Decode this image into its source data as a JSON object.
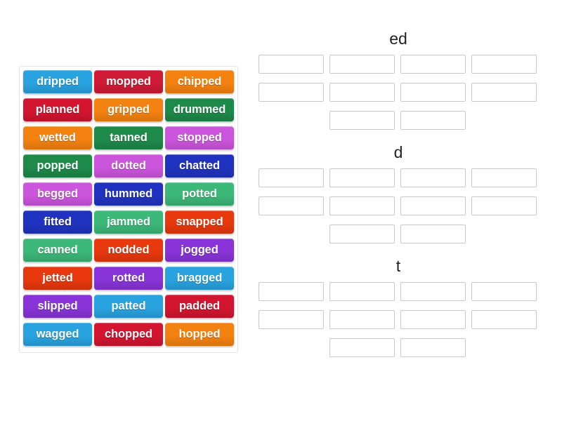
{
  "activity": {
    "type": "group-sort-drag-and-drop",
    "tile_bank": {
      "name": "word-tile-bank",
      "columns": 3,
      "tiles": [
        {
          "label": "dripped",
          "color": "#29a3e0"
        },
        {
          "label": "mopped",
          "color": "#d01b36"
        },
        {
          "label": "chipped",
          "color": "#f48210"
        },
        {
          "label": "planned",
          "color": "#d3152f"
        },
        {
          "label": "gripped",
          "color": "#f48210"
        },
        {
          "label": "drummed",
          "color": "#1d8a4a"
        },
        {
          "label": "wetted",
          "color": "#f48210"
        },
        {
          "label": "tanned",
          "color": "#1d8a4a"
        },
        {
          "label": "stopped",
          "color": "#cc55dd"
        },
        {
          "label": "popped",
          "color": "#1d8a4a"
        },
        {
          "label": "dotted",
          "color": "#cc55dd"
        },
        {
          "label": "chatted",
          "color": "#2033c0"
        },
        {
          "label": "begged",
          "color": "#cc55dd"
        },
        {
          "label": "hummed",
          "color": "#2033c0"
        },
        {
          "label": "potted",
          "color": "#3cb878"
        },
        {
          "label": "fitted",
          "color": "#2033c0"
        },
        {
          "label": "jammed",
          "color": "#3cb878"
        },
        {
          "label": "snapped",
          "color": "#e8380d"
        },
        {
          "label": "canned",
          "color": "#3cb878"
        },
        {
          "label": "nodded",
          "color": "#e8380d"
        },
        {
          "label": "jogged",
          "color": "#8834d8"
        },
        {
          "label": "jetted",
          "color": "#e8380d"
        },
        {
          "label": "rotted",
          "color": "#8834d8"
        },
        {
          "label": "bragged",
          "color": "#29a3e0"
        },
        {
          "label": "slipped",
          "color": "#8834d8"
        },
        {
          "label": "patted",
          "color": "#29a3e0"
        },
        {
          "label": "padded",
          "color": "#d3152f"
        },
        {
          "label": "wagged",
          "color": "#29a3e0"
        },
        {
          "label": "chopped",
          "color": "#d3152f"
        },
        {
          "label": "hopped",
          "color": "#f48210"
        }
      ]
    },
    "groups": [
      {
        "title": "ed",
        "slot_count": 10,
        "slots": [
          "",
          "",
          "",
          "",
          "",
          "",
          "",
          "",
          "",
          ""
        ]
      },
      {
        "title": "d",
        "slot_count": 10,
        "slots": [
          "",
          "",
          "",
          "",
          "",
          "",
          "",
          "",
          "",
          ""
        ]
      },
      {
        "title": "t",
        "slot_count": 10,
        "slots": [
          "",
          "",
          "",
          "",
          "",
          "",
          "",
          "",
          "",
          ""
        ]
      }
    ]
  },
  "colors": {
    "page_background": "#ffffff",
    "tile_bank_border": "#e3e3e3",
    "slot_border": "#c9c9c9",
    "title_text": "#222222",
    "tile_text": "#ffffff"
  }
}
